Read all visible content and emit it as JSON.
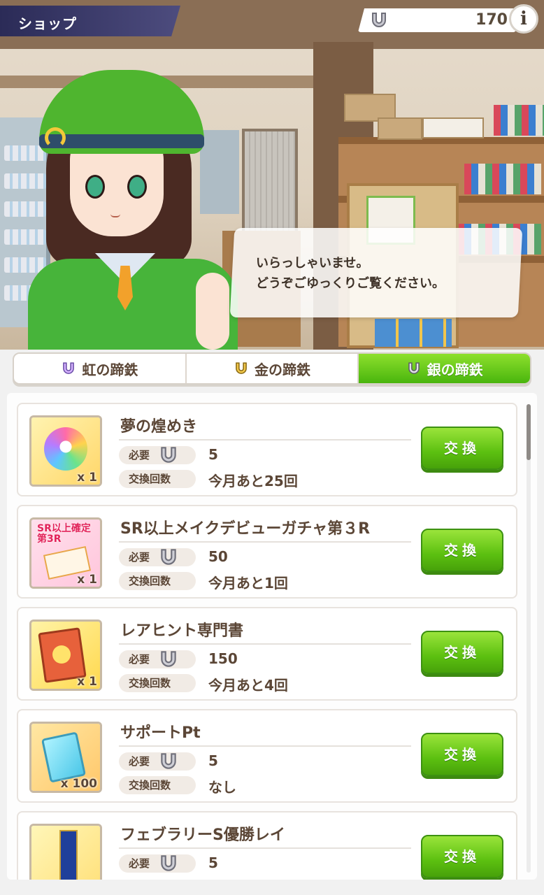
{
  "header": {
    "title": "ショップ",
    "currency_amount": "170",
    "info_label": "i"
  },
  "dialog": {
    "line1": "いらっしゃいませ。",
    "line2": "どうぞごゆっくりご覧ください。"
  },
  "tabs": [
    {
      "label": "虹の蹄鉄",
      "active": false
    },
    {
      "label": "金の蹄鉄",
      "active": false
    },
    {
      "label": "銀の蹄鉄",
      "active": true
    }
  ],
  "labels": {
    "required": "必要",
    "exchange_count": "交換回数",
    "exchange_button": "交換"
  },
  "items": [
    {
      "name": "夢の煌めき",
      "qty": "x 1",
      "cost": "5",
      "remaining": "今月あと25回"
    },
    {
      "name": "SR以上メイクデビューガチャ第３R",
      "qty": "x 1",
      "cost": "50",
      "remaining": "今月あと1回",
      "icon_text": "SR以上確定第3R"
    },
    {
      "name": "レアヒント専門書",
      "qty": "x 1",
      "cost": "150",
      "remaining": "今月あと4回"
    },
    {
      "name": "サポートPt",
      "qty": "x 100",
      "cost": "5",
      "remaining": "なし"
    },
    {
      "name": "フェブラリーS優勝レイ",
      "qty": "",
      "cost": "5",
      "remaining": ""
    }
  ],
  "colors": {
    "accent_green": "#5cc010",
    "header_bg": "#2b2b57",
    "text_brown": "#5b4636"
  },
  "icons": {
    "currency": "horseshoe-silver-icon",
    "info": "info-icon"
  }
}
